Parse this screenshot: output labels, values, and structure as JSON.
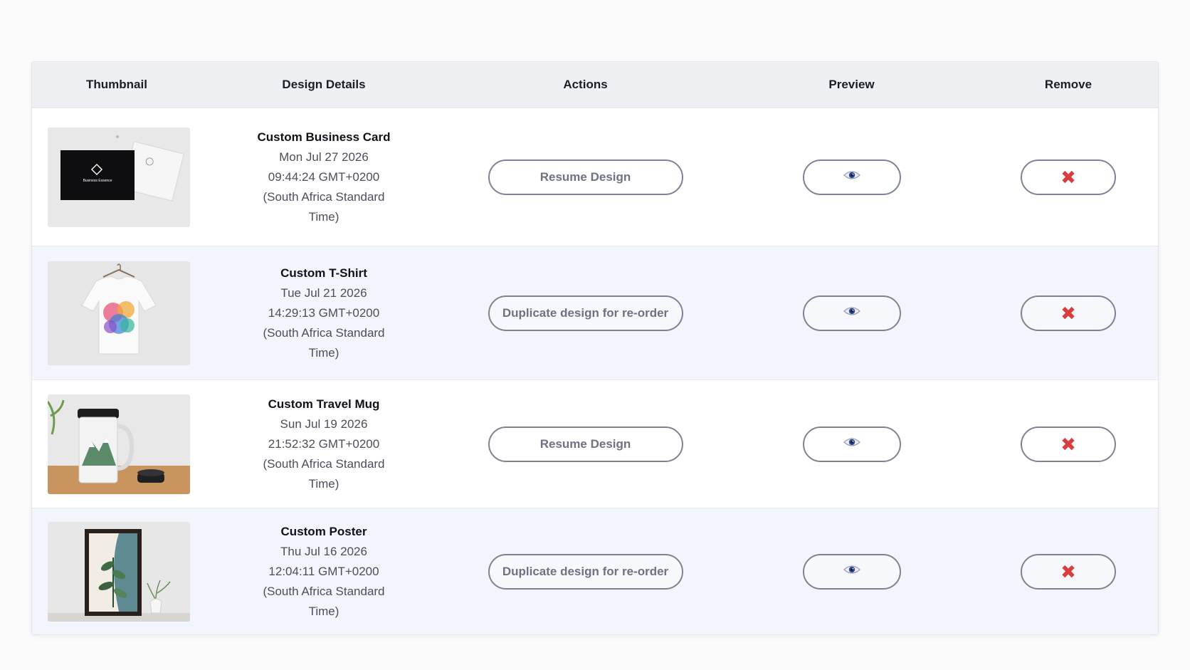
{
  "table": {
    "headers": {
      "thumbnail": "Thumbnail",
      "details": "Design Details",
      "actions": "Actions",
      "preview": "Preview",
      "remove": "Remove"
    },
    "rows": [
      {
        "name": "Custom Business Card",
        "date_line1": "Mon Jul 27 2026",
        "date_line2": "09:44:24 GMT+0200",
        "date_line3": "(South Africa Standard",
        "date_line4": "Time)",
        "action_label": "Resume Design",
        "thumbnail_icon": "business-card-thumbnail",
        "card_text": "Business Essence"
      },
      {
        "name": "Custom T-Shirt",
        "date_line1": "Tue Jul 21 2026",
        "date_line2": "14:29:13 GMT+0200",
        "date_line3": "(South Africa Standard",
        "date_line4": "Time)",
        "action_label": "Duplicate design for re-order",
        "thumbnail_icon": "tshirt-thumbnail"
      },
      {
        "name": "Custom Travel Mug",
        "date_line1": "Sun Jul 19 2026",
        "date_line2": "21:52:32 GMT+0200",
        "date_line3": "(South Africa Standard",
        "date_line4": "Time)",
        "action_label": "Resume Design",
        "thumbnail_icon": "travel-mug-thumbnail"
      },
      {
        "name": "Custom Poster",
        "date_line1": "Thu Jul 16 2026",
        "date_line2": "12:04:11 GMT+0200",
        "date_line3": "(South Africa Standard",
        "date_line4": "Time)",
        "action_label": "Duplicate design for re-order",
        "thumbnail_icon": "poster-thumbnail"
      }
    ]
  },
  "icons": {
    "preview": "eye-icon",
    "remove": "close-icon",
    "remove_glyph": "✖"
  },
  "colors": {
    "remove_red": "#d93d3d",
    "eye_blue": "#2c4a9a",
    "button_border": "#7d8394"
  }
}
